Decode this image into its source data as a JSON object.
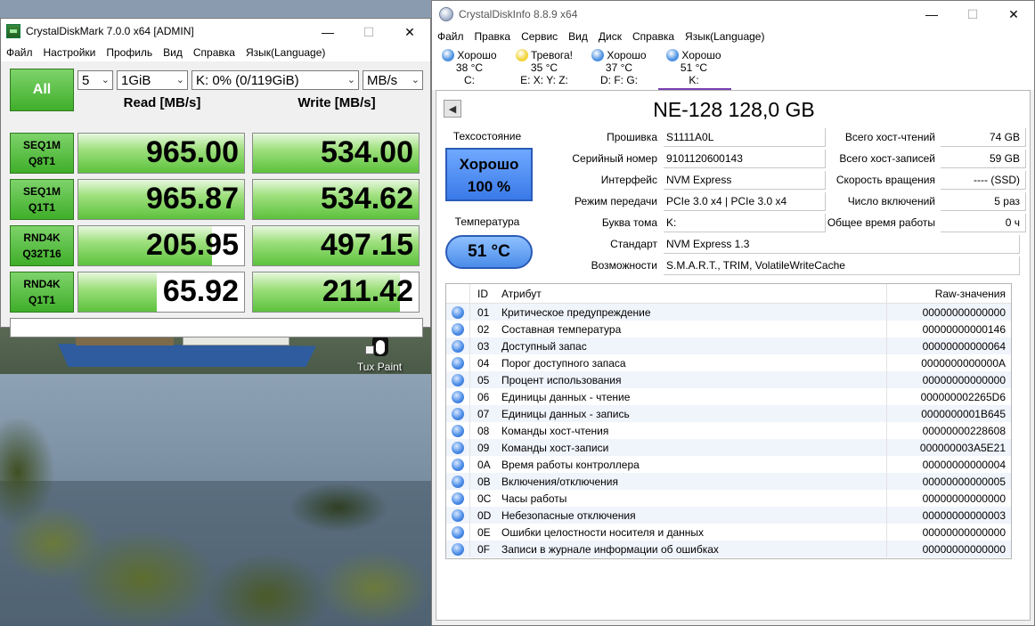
{
  "desktop": {
    "icon_label": "Tux Paint"
  },
  "cdm": {
    "title": "CrystalDiskMark 7.0.0 x64 [ADMIN]",
    "menu": [
      "Файл",
      "Настройки",
      "Профиль",
      "Вид",
      "Справка",
      "Язык(Language)"
    ],
    "all_button": "All",
    "count": "5",
    "size": "1GiB",
    "drive": "K: 0% (0/119GiB)",
    "unit": "MB/s",
    "read_header": "Read [MB/s]",
    "write_header": "Write [MB/s]",
    "tests": [
      {
        "line1": "SEQ1M",
        "line2": "Q8T1",
        "read": "965.00",
        "write": "534.00",
        "read_fill": 1.0,
        "write_fill": 1.0
      },
      {
        "line1": "SEQ1M",
        "line2": "Q1T1",
        "read": "965.87",
        "write": "534.62",
        "read_fill": 1.0,
        "write_fill": 1.0
      },
      {
        "line1": "RND4K",
        "line2": "Q32T16",
        "read": "205.95",
        "write": "497.15",
        "read_fill": 0.8,
        "write_fill": 1.0
      },
      {
        "line1": "RND4K",
        "line2": "Q1T1",
        "read": "65.92",
        "write": "211.42",
        "read_fill": 0.47,
        "write_fill": 0.88
      }
    ],
    "comment": ""
  },
  "cdi": {
    "title": "CrystalDiskInfo 8.8.9 x64",
    "menu": [
      "Файл",
      "Правка",
      "Сервис",
      "Вид",
      "Диск",
      "Справка",
      "Язык(Language)"
    ],
    "drives": [
      {
        "status": "Хорошо",
        "temp": "38 °C",
        "letters": "C:",
        "color": "#4a90e2"
      },
      {
        "status": "Тревога!",
        "temp": "35 °C",
        "letters": "E: X: Y: Z:",
        "color": "#f2d335"
      },
      {
        "status": "Хорошо",
        "temp": "37 °C",
        "letters": "D: F: G:",
        "color": "#4a90e2"
      },
      {
        "status": "Хорошо",
        "temp": "51 °C",
        "letters": "K:",
        "color": "#4a90e2"
      }
    ],
    "model": "NE-128 128,0 GB",
    "state_label": "Техсостояние",
    "health_status": "Хорошо",
    "health_percent": "100 %",
    "temp_label": "Температура",
    "temperature": "51 °C",
    "info": {
      "firmware_label": "Прошивка",
      "firmware": "S1111A0L",
      "serial_label": "Серийный номер",
      "serial": "9101120600143",
      "interface_label": "Интерфейс",
      "interface": "NVM Express",
      "transfer_label": "Режим передачи",
      "transfer": "PCIe 3.0 x4 | PCIe 3.0 x4",
      "volume_label": "Буква тома",
      "volume": "K:",
      "standard_label": "Стандарт",
      "standard": "NVM Express 1.3",
      "features_label": "Возможности",
      "features": "S.M.A.R.T., TRIM, VolatileWriteCache",
      "host_reads_label": "Всего хост-чтений",
      "host_reads": "74 GB",
      "host_writes_label": "Всего хост-записей",
      "host_writes": "59 GB",
      "rotation_label": "Скорость вращения",
      "rotation": "---- (SSD)",
      "power_count_label": "Число включений",
      "power_count": "5 раз",
      "power_hours_label": "Общее время работы",
      "power_hours": "0 ч"
    },
    "smart_header": {
      "id": "ID",
      "attr": "Атрибут",
      "raw": "Raw-значения"
    },
    "smart": [
      {
        "id": "01",
        "attr": "Критическое предупреждение",
        "raw": "00000000000000"
      },
      {
        "id": "02",
        "attr": "Составная температура",
        "raw": "00000000000146"
      },
      {
        "id": "03",
        "attr": "Доступный запас",
        "raw": "00000000000064"
      },
      {
        "id": "04",
        "attr": "Порог доступного запаса",
        "raw": "0000000000000A"
      },
      {
        "id": "05",
        "attr": "Процент использования",
        "raw": "00000000000000"
      },
      {
        "id": "06",
        "attr": "Единицы данных - чтение",
        "raw": "000000002265D6"
      },
      {
        "id": "07",
        "attr": "Единицы данных - запись",
        "raw": "0000000001B645"
      },
      {
        "id": "08",
        "attr": "Команды хост-чтения",
        "raw": "00000000228608"
      },
      {
        "id": "09",
        "attr": "Команды хост-записи",
        "raw": "000000003A5E21"
      },
      {
        "id": "0A",
        "attr": "Время работы контроллера",
        "raw": "00000000000004"
      },
      {
        "id": "0B",
        "attr": "Включения/отключения",
        "raw": "00000000000005"
      },
      {
        "id": "0C",
        "attr": "Часы работы",
        "raw": "00000000000000"
      },
      {
        "id": "0D",
        "attr": "Небезопасные отключения",
        "raw": "00000000000003"
      },
      {
        "id": "0E",
        "attr": "Ошибки целостности носителя и данных",
        "raw": "00000000000000"
      },
      {
        "id": "0F",
        "attr": "Записи в журнале информации об ошибках",
        "raw": "00000000000000"
      }
    ]
  }
}
